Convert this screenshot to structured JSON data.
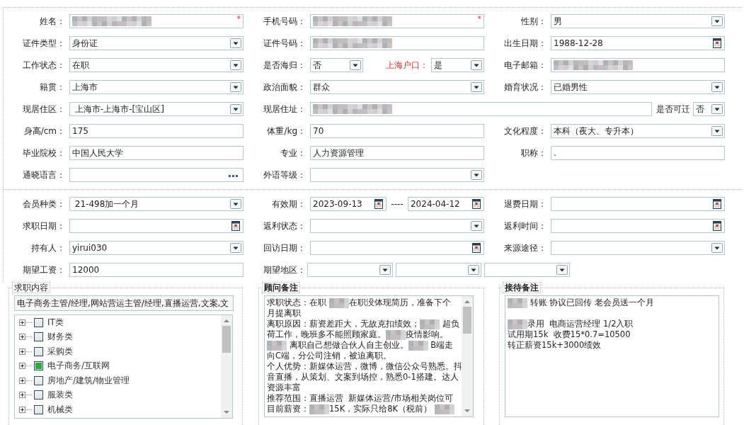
{
  "basic_info": {
    "rows": [
      [
        {
          "label": "姓名：",
          "field": {
            "kind": "text",
            "blurred": true,
            "required_mark": "*"
          }
        },
        {
          "label": "手机号码：",
          "field": {
            "kind": "text",
            "blurred": true,
            "required_mark": "*"
          }
        },
        {
          "label": "性别：",
          "field": {
            "kind": "select",
            "value": "男"
          }
        }
      ],
      [
        {
          "label": "证件类型：",
          "field": {
            "kind": "select",
            "value": "身份证"
          }
        },
        {
          "label": "证件号码：",
          "field": {
            "kind": "text",
            "blurred": true
          }
        },
        {
          "label": "出生日期：",
          "field": {
            "kind": "date",
            "value": "1988-12-28"
          }
        }
      ],
      [
        {
          "label": "工作状态：",
          "field": {
            "kind": "select",
            "value": "在职"
          }
        },
        {
          "label": "是否海归：",
          "field": {
            "kind": "select",
            "value": "否"
          },
          "extra": {
            "label": "上海户口：",
            "emphasis": true,
            "field": {
              "kind": "select",
              "value": "是"
            }
          }
        },
        {
          "label": "电子邮箱：",
          "field": {
            "kind": "text",
            "blurred": true
          }
        }
      ],
      [
        {
          "label": "籍贯：",
          "field": {
            "kind": "select",
            "value": "上海市"
          }
        },
        {
          "label": "政治面貌：",
          "field": {
            "kind": "select",
            "value": "群众"
          }
        },
        {
          "label": "婚育状况：",
          "field": {
            "kind": "select",
            "value": "已婚男性"
          }
        }
      ],
      [
        {
          "label": "现居住区：",
          "field": {
            "kind": "select",
            "value": " 上海市-上海市-[宝山区]"
          }
        },
        {
          "label": "现居住址：",
          "field": {
            "kind": "text",
            "blurred": true
          },
          "extra": {
            "label": "是否可迁",
            "field": {
              "kind": "select",
              "value": "否"
            }
          }
        }
      ],
      [
        {
          "label": "身高/cm：",
          "field": {
            "kind": "text",
            "value": "175"
          }
        },
        {
          "label": "体重/kg：",
          "field": {
            "kind": "text",
            "value": "70"
          }
        },
        {
          "label": "文化程度：",
          "field": {
            "kind": "select",
            "value": "本科（夜大、专升本）"
          }
        }
      ],
      [
        {
          "label": "毕业院校：",
          "field": {
            "kind": "text",
            "value": "中国人民大学"
          }
        },
        {
          "label": "专业：",
          "field": {
            "kind": "text",
            "value": "人力资源管理"
          }
        },
        {
          "label": "职称：",
          "field": {
            "kind": "text",
            "value": "."
          }
        }
      ],
      [
        {
          "label": "通晓语言：",
          "field": {
            "kind": "picker"
          }
        },
        {
          "label": "外语等级：",
          "field": {
            "kind": "select"
          }
        }
      ]
    ]
  },
  "membership": {
    "rows": [
      [
        {
          "label": "会员种类：",
          "field": {
            "kind": "select",
            "value": " 21-498加一个月"
          }
        },
        {
          "label": "有效期：",
          "field": {
            "kind": "date",
            "value": "2023-09-13"
          },
          "extra": {
            "separator": "----",
            "field": {
              "kind": "date",
              "value": "2024-04-12"
            }
          }
        },
        {
          "label": "退费日期：",
          "field": {
            "kind": "date"
          }
        }
      ],
      [
        {
          "label": "求职日期：",
          "field": {
            "kind": "date"
          }
        },
        {
          "label": "返利状态：",
          "field": {
            "kind": "select"
          }
        },
        {
          "label": "返利时间：",
          "field": {
            "kind": "date"
          }
        }
      ],
      [
        {
          "label": "持有人：",
          "field": {
            "kind": "select",
            "value": "yirui030"
          }
        },
        {
          "label": "回访日期：",
          "field": {
            "kind": "date"
          }
        },
        {
          "label": "来源途径：",
          "field": {
            "kind": "select"
          }
        }
      ],
      [
        {
          "label": "期望工资：",
          "field": {
            "kind": "text",
            "value": "12000"
          }
        },
        {
          "label": "期望地区：",
          "field": {
            "kind": "select_group",
            "parts": [
              {
                "kind": "select"
              },
              {
                "kind": "select"
              },
              {
                "kind": "select"
              }
            ]
          }
        }
      ]
    ]
  },
  "job_intent": {
    "title": "求职内容",
    "summary": "电子商务主管/经理,网站营运主管/经理,直播运营,文案,文",
    "categories": [
      {
        "label": "IT类",
        "checked": false,
        "expanded": false
      },
      {
        "label": "财务类",
        "checked": false,
        "expanded": false
      },
      {
        "label": "采购类",
        "checked": false,
        "expanded": false
      },
      {
        "label": "电子商务/互联网",
        "checked": true,
        "expanded": false
      },
      {
        "label": "房地产/建筑/物业管理",
        "checked": false,
        "expanded": false
      },
      {
        "label": "服装类",
        "checked": false,
        "expanded": false
      },
      {
        "label": "机械类",
        "checked": false,
        "expanded": false
      }
    ]
  },
  "consultant_notes": {
    "title": "顾问备注",
    "lines": [
      {
        "segments": [
          {
            "text": "求职状态：在职 "
          },
          {
            "kind": "redacted"
          },
          {
            "text": "在职没体现简历，准备下个"
          }
        ]
      },
      {
        "segments": [
          {
            "text": "月提离职"
          }
        ]
      },
      {
        "segments": [
          {
            "text": "离职原因：薪资差距大，无故克扣绩效；"
          },
          {
            "kind": "redacted"
          },
          {
            "text": " 超负"
          }
        ]
      },
      {
        "segments": [
          {
            "text": "荷工作，晚班多不能照顾家庭。"
          },
          {
            "kind": "redacted"
          },
          {
            "text": "疫情影响。"
          }
        ]
      },
      {
        "segments": [
          {
            "kind": "redacted"
          },
          {
            "text": " 离职自己想做合伙人自主创业。"
          },
          {
            "kind": "redacted"
          },
          {
            "text": " B端走"
          }
        ]
      },
      {
        "segments": [
          {
            "text": "向C端，分公司注销，被迫离职。"
          }
        ]
      },
      {
        "segments": [
          {
            "text": "个人优势：新媒体运营，微博，微信公众号熟悉。抖"
          }
        ]
      },
      {
        "segments": [
          {
            "text": "音直播，从策划、文案到场控，熟悉0-1搭建。达人"
          }
        ]
      },
      {
        "segments": [
          {
            "text": "资源丰富"
          }
        ]
      },
      {
        "segments": [
          {
            "text": "推荐范围：直播运营  新媒体运营/市场相关岗位可"
          }
        ]
      },
      {
        "segments": [
          {
            "text": "目前薪资："
          },
          {
            "kind": "redacted"
          },
          {
            "text": "15K，实际只给8K（税前） "
          },
          {
            "kind": "redacted"
          }
        ]
      }
    ]
  },
  "reception_notes": {
    "title": "接待备注",
    "lines": [
      {
        "segments": [
          {
            "kind": "redacted"
          },
          {
            "text": " 转账 协议已回传 老会员送一个月"
          }
        ]
      },
      {
        "kind": "blank"
      },
      {
        "segments": [
          {
            "kind": "redacted"
          },
          {
            "text": "录用  电商运营经理 1/2入职"
          }
        ]
      },
      {
        "segments": [
          {
            "text": "试用期15k  收费15*0.7=10500"
          }
        ]
      },
      {
        "segments": [
          {
            "text": "转正薪资15k+3000绩效"
          }
        ]
      }
    ]
  }
}
